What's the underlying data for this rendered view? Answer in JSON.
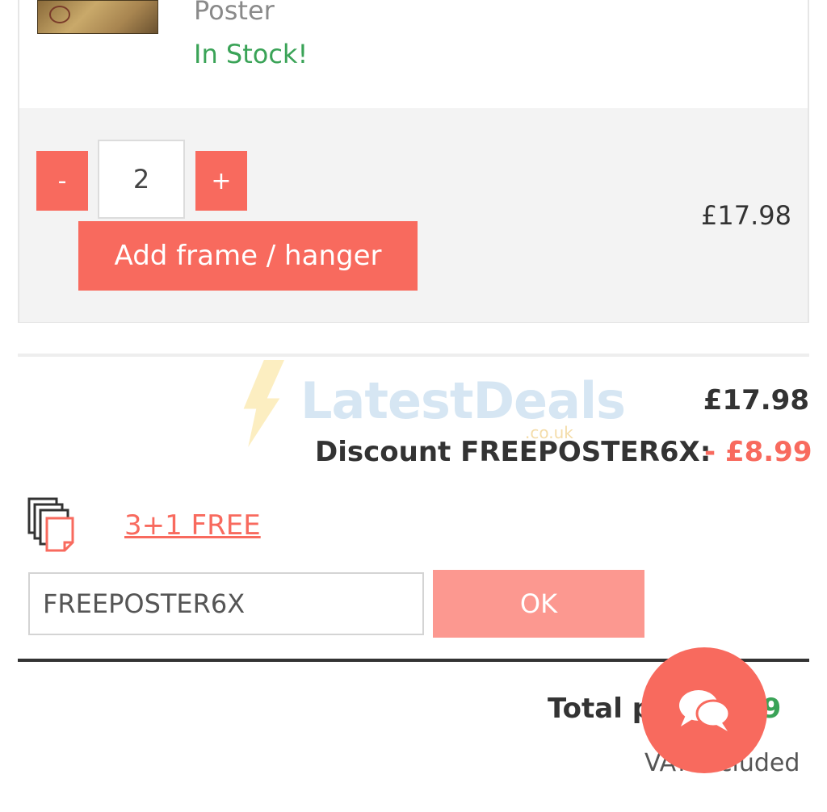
{
  "product": {
    "name_tail": "Poster",
    "stock_status": "In Stock!",
    "quantity": "2",
    "minus_label": "-",
    "plus_label": "+",
    "frame_button": "Add frame / hanger",
    "line_price": "£17.98"
  },
  "watermark": {
    "brand": "LatestDeals",
    "sub": ".co.uk"
  },
  "summary": {
    "subtotal": "£17.98",
    "discount_label": "Discount FREEPOSTER6X:",
    "discount_value": "- £8.99",
    "promo_link": "3+1 FREE",
    "coupon_value": "FREEPOSTER6X",
    "ok_label": "OK",
    "total_label": "Total p",
    "total_value": "99",
    "vat_text": "VAT included"
  },
  "colors": {
    "accent": "#f86a5e",
    "accent_light": "#fc9890",
    "success": "#3aa357"
  },
  "icons": [
    "stacked-pages-icon",
    "chat-bubbles-icon",
    "lightning-icon"
  ]
}
